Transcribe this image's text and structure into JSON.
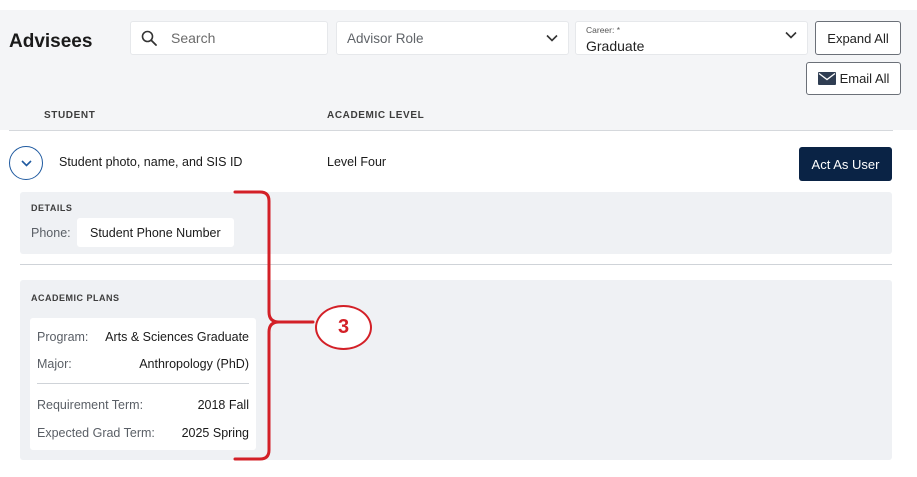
{
  "header": {
    "title": "Advisees",
    "search_placeholder": "Search",
    "advisor_role_placeholder": "Advisor Role",
    "career_label": "Career: *",
    "career_value": "Graduate",
    "expand_all_label": "Expand All",
    "email_all_label": "Email All"
  },
  "table": {
    "columns": [
      "STUDENT",
      "ACADEMIC LEVEL"
    ],
    "row": {
      "student": "Student photo, name, and SIS ID",
      "level": "Level Four",
      "action_label": "Act As User"
    }
  },
  "details": {
    "section_label": "DETAILS",
    "phone_label": "Phone:",
    "phone_value": "Student Phone Number"
  },
  "plans": {
    "section_label": "ACADEMIC PLANS",
    "program_label": "Program:",
    "program_value": "Arts & Sciences Graduate",
    "major_label": "Major:",
    "major_value": "Anthropology (PhD)",
    "req_term_label": "Requirement Term:",
    "req_term_value": "2018 Fall",
    "grad_term_label": "Expected Grad Term:",
    "grad_term_value": "2025 Spring"
  },
  "annotation": {
    "callout_number": "3",
    "color": "#d32027"
  },
  "colors": {
    "primary_button": "#0a2345",
    "panel_bg": "#eff1f4",
    "toggle_border": "#1f5aa0"
  }
}
